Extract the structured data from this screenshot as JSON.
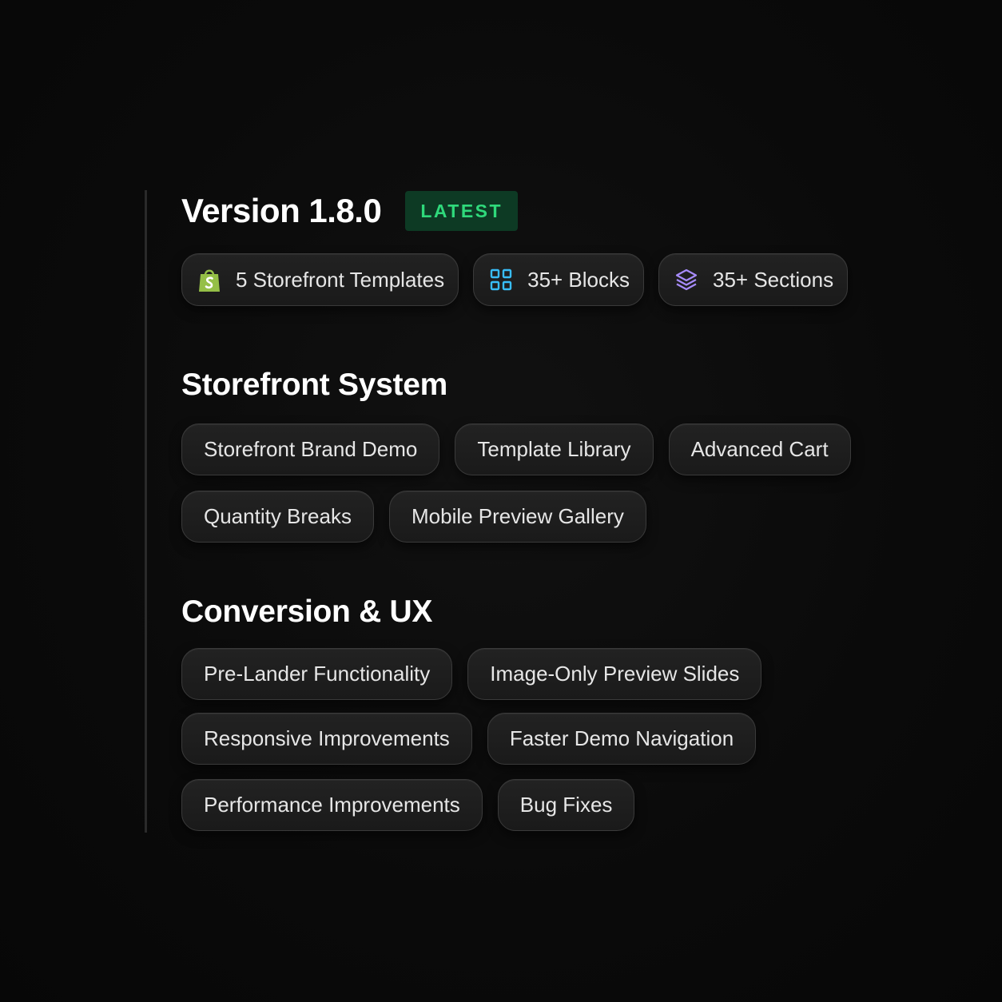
{
  "release": {
    "version_title": "Version 1.8.0",
    "badge": "LATEST",
    "badge_color": "#2fd97b",
    "stats": [
      {
        "label": "5 Storefront Templates",
        "icon": "shopify-bag-icon",
        "icon_color": "#95bf47"
      },
      {
        "label": "35+ Blocks",
        "icon": "grid-icon",
        "icon_color": "#38bdf8"
      },
      {
        "label": "35+ Sections",
        "icon": "layers-icon",
        "icon_color": "#a78bfa"
      }
    ]
  },
  "sections": [
    {
      "title": "Storefront System",
      "rows": [
        [
          "Storefront Brand Demo",
          "Template Library",
          "Advanced Cart"
        ],
        [
          "Quantity Breaks",
          "Mobile Preview Gallery"
        ]
      ]
    },
    {
      "title": "Conversion & UX",
      "rows": [
        [
          "Pre-Lander Functionality",
          "Image-Only Preview Slides"
        ],
        [
          "Responsive Improvements",
          "Faster Demo Navigation"
        ],
        [
          "Performance Improvements",
          "Bug Fixes"
        ]
      ]
    }
  ]
}
